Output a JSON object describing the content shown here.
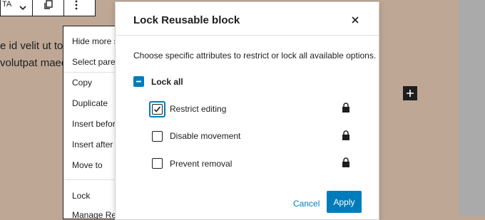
{
  "toolbar": {
    "truncated_text": "TA",
    "icons": [
      "chevron-down-icon",
      "copy-icon",
      "more-vertical-icon"
    ]
  },
  "background_text": {
    "line1": "e id velit ut tor",
    "line2": "volutpat maec"
  },
  "menu": {
    "items": [
      "Hide more s",
      "Select paren",
      "Copy",
      "Duplicate",
      "Insert before",
      "Insert after",
      "Move to",
      "Lock",
      "Manage Re"
    ]
  },
  "modal": {
    "title": "Lock Reusable block",
    "description": "Choose specific attributes to restrict or lock all available options.",
    "lock_all": {
      "label": "Lock all",
      "state": "indeterminate"
    },
    "options": [
      {
        "label": "Restrict editing",
        "checked": true,
        "icon": "lock-icon"
      },
      {
        "label": "Disable movement",
        "checked": false,
        "icon": "lock-icon"
      },
      {
        "label": "Prevent removal",
        "checked": false,
        "icon": "lock-icon"
      }
    ],
    "cancel_label": "Cancel",
    "apply_label": "Apply"
  },
  "colors": {
    "accent": "#007cba",
    "backdrop": "#bea795",
    "text": "#1e1e1e"
  }
}
